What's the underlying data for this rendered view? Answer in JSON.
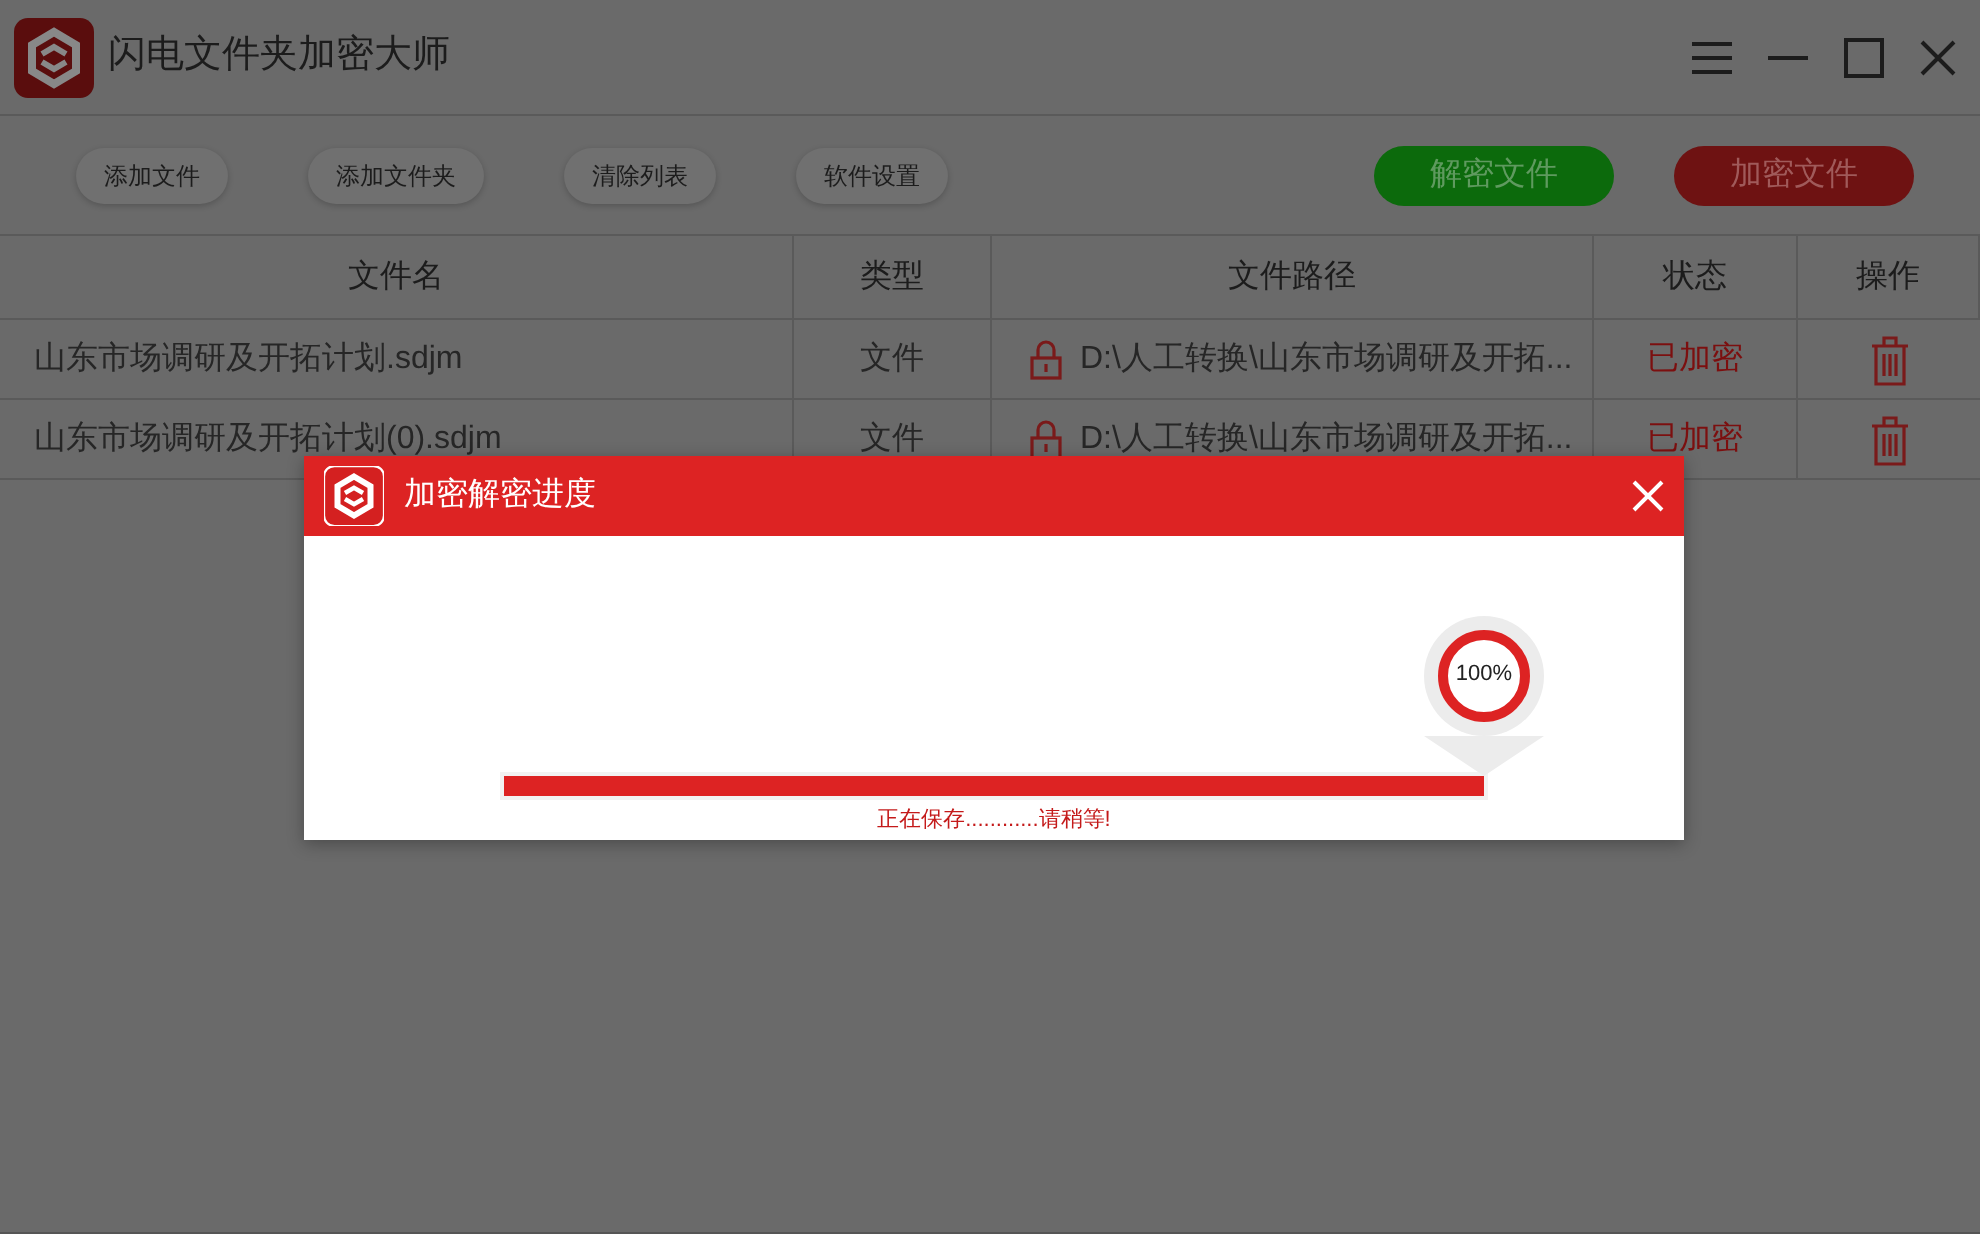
{
  "window": {
    "title": "闪电文件夹加密大师"
  },
  "toolbar": [
    "添加文件",
    "添加文件夹",
    "清除列表",
    "软件设置"
  ],
  "actions": [
    {
      "label": "解密文件",
      "kind": "decrypt"
    },
    {
      "label": "加密文件",
      "kind": "encrypt"
    }
  ],
  "table": {
    "columns": [
      "文件名",
      "类型",
      "文件路径",
      "状态",
      "操作"
    ],
    "rows": [
      {
        "name": "山东市场调研及开拓计划.sdjm",
        "type": "文件",
        "path": "D:\\人工转换\\山东市场调研及开拓...",
        "status": "已加密"
      },
      {
        "name": "山东市场调研及开拓计划(0).sdjm",
        "type": "文件",
        "path": "D:\\人工转换\\山东市场调研及开拓...",
        "status": "已加密"
      }
    ]
  },
  "dialog": {
    "title": "加密解密进度",
    "progress": {
      "level": 1,
      "reading": "100%"
    },
    "message": "正在保存............请稍等!"
  }
}
